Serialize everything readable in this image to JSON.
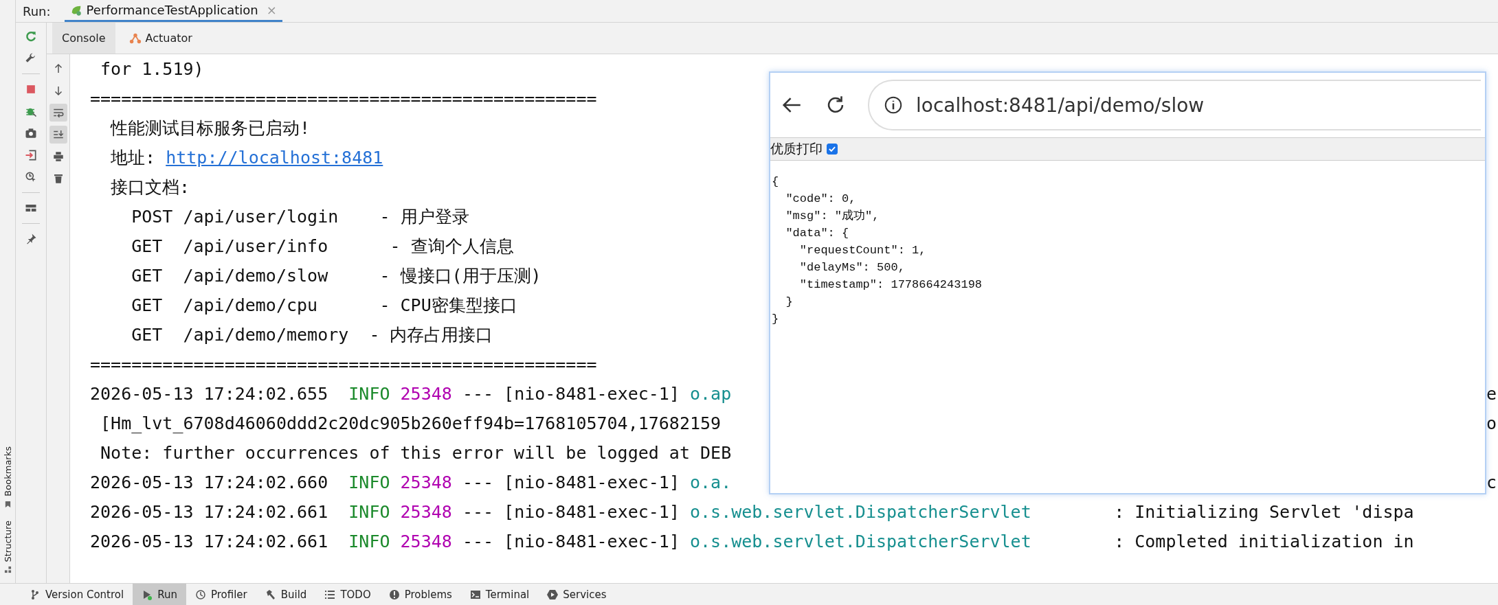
{
  "run_bar": {
    "label": "Run:",
    "tab": {
      "title": "PerformanceTestApplication",
      "close": "×",
      "selected": true
    }
  },
  "left_toolbar": [
    {
      "kind": "rerun"
    },
    {
      "kind": "wrench"
    },
    {
      "kind": "stop"
    },
    {
      "kind": "debug"
    },
    {
      "kind": "camera"
    },
    {
      "kind": "login"
    },
    {
      "kind": "inspect"
    },
    {
      "kind": "layout"
    },
    {
      "kind": "pin"
    }
  ],
  "console_toolbar": [
    {
      "kind": "up",
      "selected": false
    },
    {
      "kind": "down",
      "selected": false
    },
    {
      "kind": "wrap",
      "selected": true
    },
    {
      "kind": "scroll-end",
      "selected": true
    },
    {
      "kind": "print",
      "selected": false
    },
    {
      "kind": "trash",
      "selected": false
    }
  ],
  "console_tabs": [
    {
      "label": "Console",
      "kind": "plain",
      "selected": true
    },
    {
      "label": "Actuator",
      "kind": "actuator",
      "selected": false
    }
  ],
  "side_stripe": [
    {
      "label": "Bookmarks",
      "kind": "bookmark"
    },
    {
      "label": "Structure",
      "kind": "structure"
    }
  ],
  "console_lines": [
    {
      "segments": [
        {
          "kind": "plain",
          "text": " for 1.519)"
        }
      ]
    },
    {
      "segments": [
        {
          "kind": "plain",
          "text": "================================================="
        }
      ]
    },
    {
      "segments": [
        {
          "kind": "plain",
          "text": "  性能测试目标服务已启动!"
        }
      ]
    },
    {
      "segments": [
        {
          "kind": "plain",
          "text": "  地址: "
        },
        {
          "kind": "link",
          "text": "http://localhost:8481"
        }
      ]
    },
    {
      "segments": [
        {
          "kind": "plain",
          "text": "  接口文档:"
        }
      ]
    },
    {
      "segments": [
        {
          "kind": "plain",
          "text": "    POST /api/user/login    - 用户登录"
        }
      ]
    },
    {
      "segments": [
        {
          "kind": "plain",
          "text": "    GET  /api/user/info      - 查询个人信息"
        }
      ]
    },
    {
      "segments": [
        {
          "kind": "plain",
          "text": "    GET  /api/demo/slow     - 慢接口(用于压测)"
        }
      ]
    },
    {
      "segments": [
        {
          "kind": "plain",
          "text": "    GET  /api/demo/cpu      - CPU密集型接口"
        }
      ]
    },
    {
      "segments": [
        {
          "kind": "plain",
          "text": "    GET  /api/demo/memory  - 内存占用接口"
        }
      ]
    },
    {
      "segments": [
        {
          "kind": "plain",
          "text": "================================================="
        }
      ]
    },
    {
      "segments": [
        {
          "kind": "plain",
          "text": "2026-05-13 17:24:02.655  "
        },
        {
          "kind": "level",
          "text": "INFO"
        },
        {
          "kind": "pid",
          "text": "25348"
        },
        {
          "kind": "plain",
          "text": " --- [nio-8481-exec-1] "
        },
        {
          "kind": "logger",
          "text": "o.ap"
        }
      ],
      "tail": "e"
    },
    {
      "segments": [
        {
          "kind": "plain",
          "text": " [Hm_lvt_6708d46060ddd2c20dc905b260eff94b=1768105704,17682159"
        }
      ],
      "tail": "o"
    },
    {
      "segments": [
        {
          "kind": "plain",
          "text": " Note: further occurrences of this error will be logged at DEB"
        }
      ]
    },
    {
      "segments": [
        {
          "kind": "plain",
          "text": "2026-05-13 17:24:02.660  "
        },
        {
          "kind": "level",
          "text": "INFO"
        },
        {
          "kind": "pid",
          "text": "25348"
        },
        {
          "kind": "plain",
          "text": " --- [nio-8481-exec-1] "
        },
        {
          "kind": "logger",
          "text": "o.a."
        }
      ],
      "tail": "c"
    },
    {
      "segments": [
        {
          "kind": "plain",
          "text": "2026-05-13 17:24:02.661  "
        },
        {
          "kind": "level",
          "text": "INFO"
        },
        {
          "kind": "pid",
          "text": "25348"
        },
        {
          "kind": "plain",
          "text": " --- [nio-8481-exec-1] "
        },
        {
          "kind": "logger",
          "text": "o.s.web.servlet.DispatcherServlet"
        },
        {
          "kind": "plain",
          "text": "        : Initializing Servlet 'dispa"
        }
      ]
    },
    {
      "segments": [
        {
          "kind": "plain",
          "text": "2026-05-13 17:24:02.661  "
        },
        {
          "kind": "level",
          "text": "INFO"
        },
        {
          "kind": "pid",
          "text": "25348"
        },
        {
          "kind": "plain",
          "text": " --- [nio-8481-exec-1] "
        },
        {
          "kind": "logger",
          "text": "o.s.web.servlet.DispatcherServlet"
        },
        {
          "kind": "plain",
          "text": "        : Completed initialization in"
        }
      ]
    }
  ],
  "browser": {
    "url": "localhost:8481/api/demo/slow",
    "print_toggle": {
      "label": "优质打印",
      "checked": true
    },
    "body_lines": [
      "{",
      "  \"code\": 0,",
      "  \"msg\": \"成功\",",
      "  \"data\": {",
      "    \"requestCount\": 1,",
      "    \"delayMs\": 500,",
      "    \"timestamp\": 1778664243198",
      "  }",
      "}"
    ]
  },
  "bottom_tabs": [
    {
      "label": "Version Control",
      "kind": "vcs",
      "selected": false
    },
    {
      "label": "Run",
      "kind": "run",
      "selected": true
    },
    {
      "label": "Profiler",
      "kind": "profiler",
      "selected": false
    },
    {
      "label": "Build",
      "kind": "build",
      "selected": false
    },
    {
      "label": "TODO",
      "kind": "todo",
      "selected": false
    },
    {
      "label": "Problems",
      "kind": "problems",
      "selected": false
    },
    {
      "label": "Terminal",
      "kind": "terminal",
      "selected": false
    },
    {
      "label": "Services",
      "kind": "services",
      "selected": false
    }
  ]
}
